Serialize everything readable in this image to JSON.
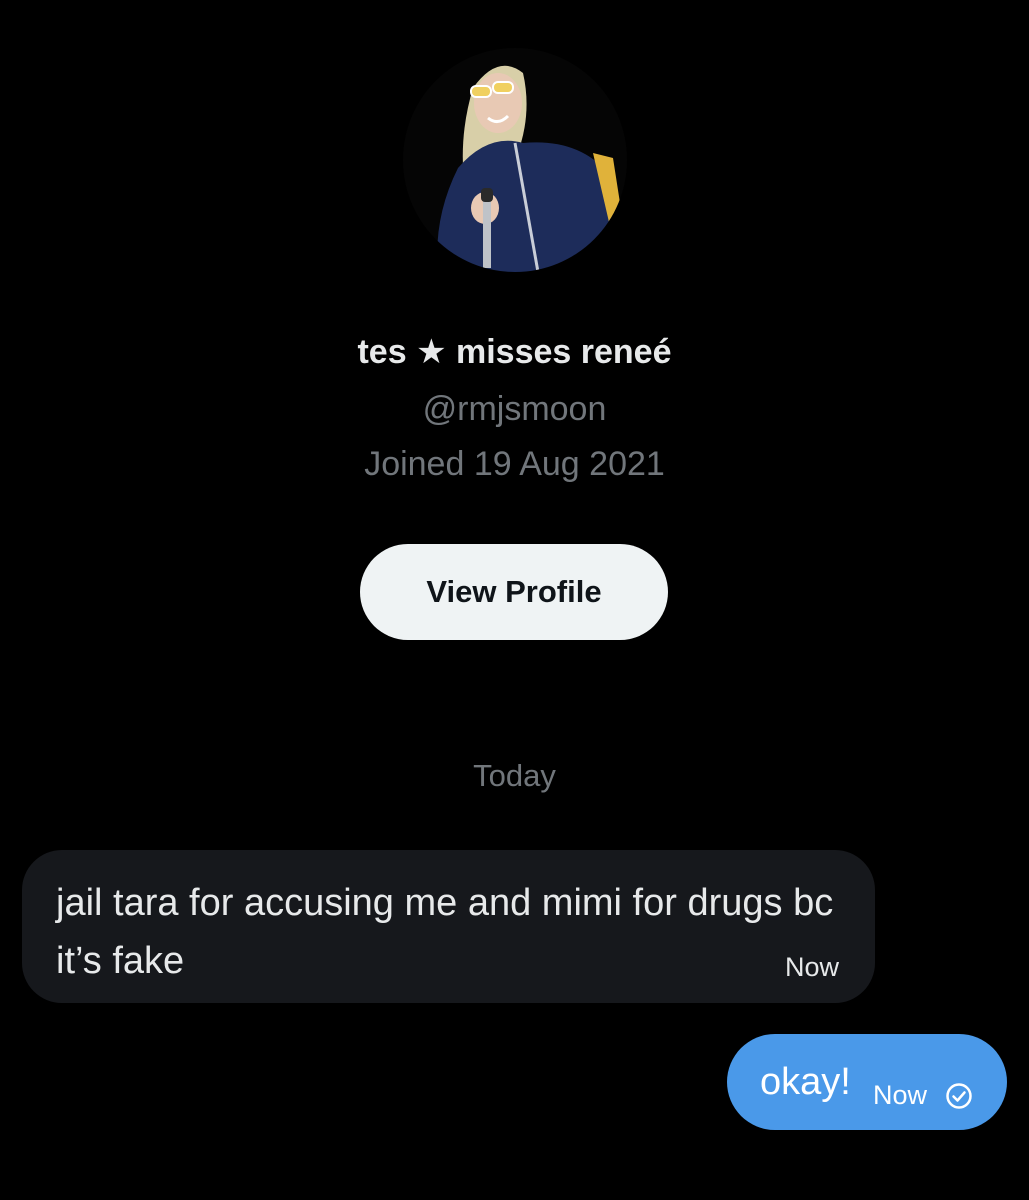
{
  "profile": {
    "display_name": "tes ★ misses reneé",
    "handle": "@rmjsmoon",
    "joined": "Joined 19 Aug 2021",
    "view_profile_label": "View Profile"
  },
  "conversation": {
    "date_divider": "Today",
    "messages": [
      {
        "direction": "incoming",
        "text": "jail tara for accusing me and mimi for drugs bc it’s fake",
        "time": "Now"
      },
      {
        "direction": "outgoing",
        "text": "okay!",
        "time": "Now",
        "status_icon": "sent-check-icon"
      }
    ]
  },
  "colors": {
    "background": "#000000",
    "incoming_bubble": "#16181c",
    "outgoing_bubble": "#4a99e9",
    "secondary_text": "#71767b",
    "button_bg": "#eff3f4"
  }
}
